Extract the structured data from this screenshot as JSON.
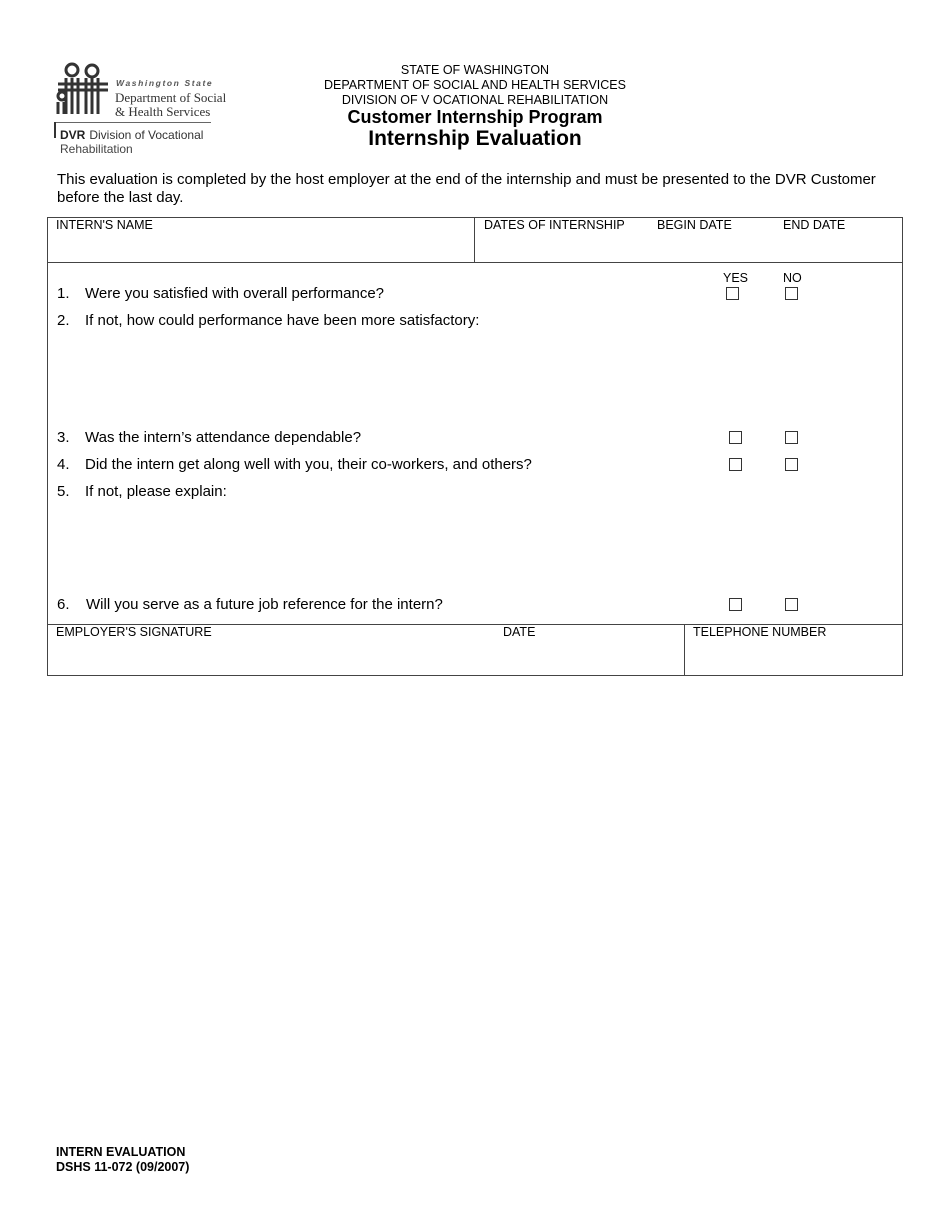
{
  "logo": {
    "state": "Washington State",
    "dept_line1": "Department of Social",
    "dept_line2": "& Health Services",
    "dvr_abbr": "DVR",
    "dvr_line1": "Division of Vocational",
    "dvr_line2": "Rehabilitation",
    "icon": "people-family-icon"
  },
  "header": {
    "line1": "STATE OF WASHINGTON",
    "line2": "DEPARTMENT OF SOCIAL AND HEALTH SERVICES",
    "line3": "DIVISION OF V OCATIONAL REHABILITATION",
    "program": "Customer Internship Program",
    "title": "Internship Evaluation"
  },
  "intro": "This evaluation is completed by the host employer at the end of the internship and must be presented to the DVR Customer before the last day.",
  "top_row": {
    "interns_name_label": "INTERN'S NAME",
    "interns_name_value": "",
    "dates_label": "DATES OF INTERNSHIP",
    "begin_label": "BEGIN DATE",
    "begin_value": "",
    "end_label": "END DATE",
    "end_value": ""
  },
  "answers": {
    "yes_label": "YES",
    "no_label": "NO"
  },
  "questions": [
    {
      "num": "1.",
      "text": "Were you satisfied with overall performance?",
      "has_checkboxes": true,
      "yes": false,
      "no": false
    },
    {
      "num": "2.",
      "text": "If not, how could performance have been more satisfactory:",
      "has_checkboxes": false,
      "response": ""
    },
    {
      "num": "3.",
      "text": "Was the intern’s attendance dependable?",
      "has_checkboxes": true,
      "yes": false,
      "no": false
    },
    {
      "num": "4.",
      "text": "Did the intern get along well with you, their co-workers, and others?",
      "has_checkboxes": true,
      "yes": false,
      "no": false
    },
    {
      "num": "5.",
      "text": "If not, please explain:",
      "has_checkboxes": false,
      "response": ""
    },
    {
      "num": "6.",
      "text": "Will you serve as a future job reference for the intern?",
      "has_checkboxes": true,
      "yes": false,
      "no": false
    }
  ],
  "bottom_row": {
    "signature_label": "EMPLOYER'S SIGNATURE",
    "date_label": "DATE",
    "telephone_label": "TELEPHONE NUMBER"
  },
  "footer": {
    "form_name": "INTERN EVALUATION",
    "form_number": "DSHS 11-072 (09/2007)"
  }
}
